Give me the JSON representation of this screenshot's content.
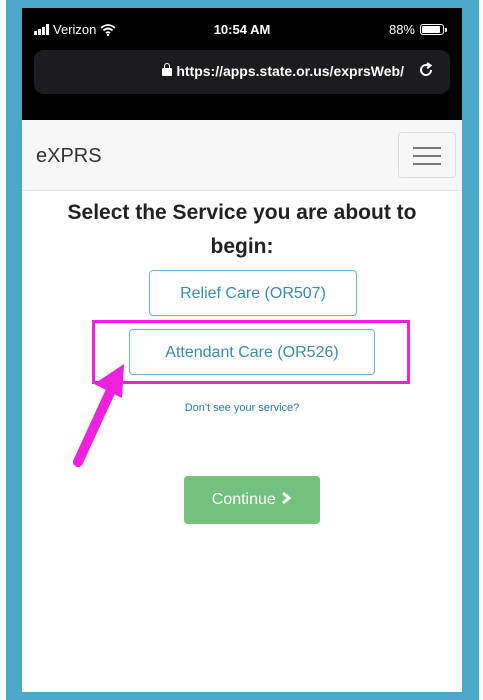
{
  "status_bar": {
    "carrier": "Verizon",
    "time": "10:54 AM",
    "battery": "88%",
    "battery_level": 0.88
  },
  "browser": {
    "url": "https://apps.state.or.us/exprsWeb/"
  },
  "navbar": {
    "brand": "eXPRS"
  },
  "main": {
    "heading": "Select the Service you are about to begin:",
    "services": [
      {
        "label": "Relief Care (OR507)"
      },
      {
        "label": "Attendant Care (OR526)"
      }
    ],
    "help_link": "Don't see your service?",
    "continue_label": "Continue"
  },
  "colors": {
    "highlight": "#ee22dd",
    "continue_bg": "#72c17e",
    "frame": "#4aa8c8"
  }
}
